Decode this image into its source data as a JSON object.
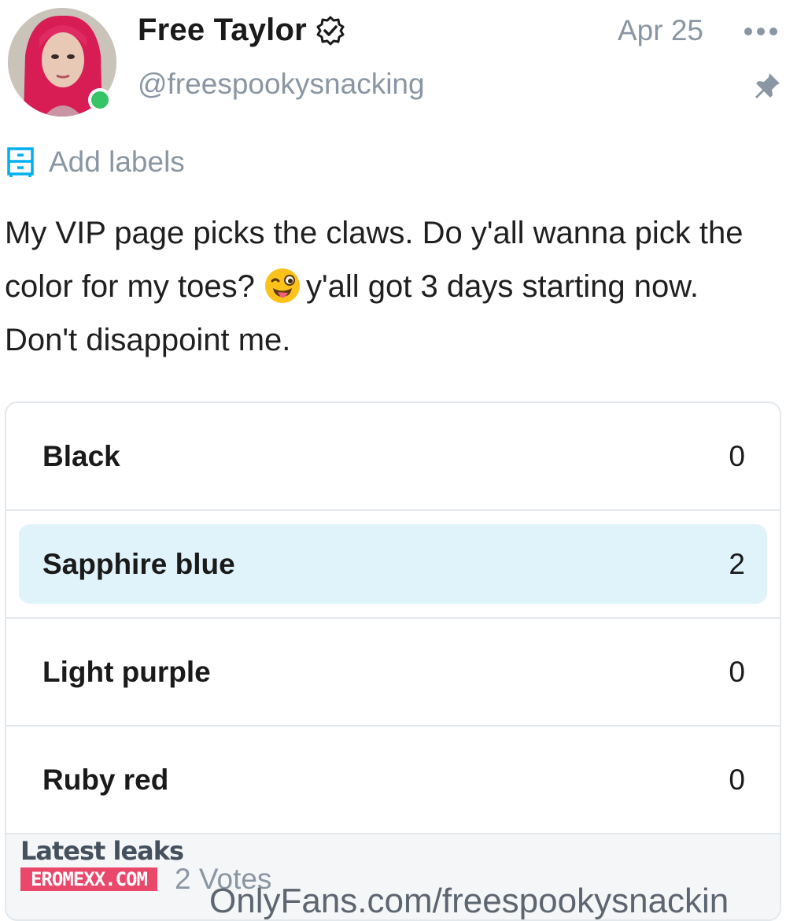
{
  "post": {
    "author_name": "Free Taylor",
    "author_handle": "@freespookysnacking",
    "date": "Apr 25",
    "add_labels": "Add labels",
    "text_part1": "My VIP page picks the claws. Do y'all wanna pick the color for my toes?",
    "emoji": "winking-face-with-tongue",
    "text_part2": "y'all got 3 days starting now. Don't disappoint me."
  },
  "poll": {
    "options": [
      {
        "label": "Black",
        "count": "0",
        "selected": false
      },
      {
        "label": "Sapphire blue",
        "count": "2",
        "selected": true
      },
      {
        "label": "Light purple",
        "count": "0",
        "selected": false
      },
      {
        "label": "Ruby red",
        "count": "0",
        "selected": false
      }
    ],
    "votes": "2 Votes"
  },
  "watermark": {
    "latest": "Latest leaks",
    "brand": "EROMEXX.COM",
    "url": "OnlyFans.com/freespookysnackin"
  },
  "colors": {
    "muted": "#8a96a3",
    "accent": "#00aff0",
    "selected_bg": "#e0f3fb",
    "online": "#36c466",
    "border": "#e3e8ec"
  },
  "icons": [
    "verified-icon",
    "more-icon",
    "pin-icon",
    "labels-icon"
  ]
}
